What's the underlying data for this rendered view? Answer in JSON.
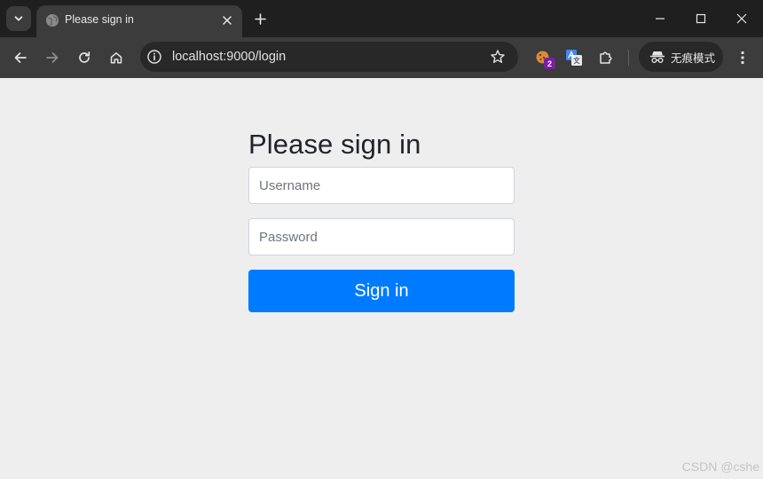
{
  "browser": {
    "tab": {
      "title": "Please sign in"
    },
    "address": {
      "url": "localhost:9000/login"
    },
    "extension_badge": "2",
    "incognito_label": "无痕模式"
  },
  "form": {
    "heading": "Please sign in",
    "username_placeholder": "Username",
    "password_placeholder": "Password",
    "submit_label": "Sign in"
  },
  "watermark": "CSDN @cshe",
  "colors": {
    "tab_strip": "#1f1f1f",
    "toolbar": "#3c3c3c",
    "page_bg": "#eeeeee",
    "primary_button": "#007bff",
    "extension_badge": "#7a1fa2"
  },
  "icons": {
    "tab_search": "chevron-down-icon",
    "favicon": "globe-icon",
    "close": "close-icon",
    "new_tab": "plus-icon",
    "back": "arrow-left-icon",
    "forward": "arrow-right-icon",
    "reload": "reload-icon",
    "home": "home-icon",
    "site_info": "info-icon",
    "bookmark": "star-icon",
    "extensions": "puzzle-icon",
    "incognito": "incognito-icon",
    "menu": "kebab-menu-icon"
  }
}
